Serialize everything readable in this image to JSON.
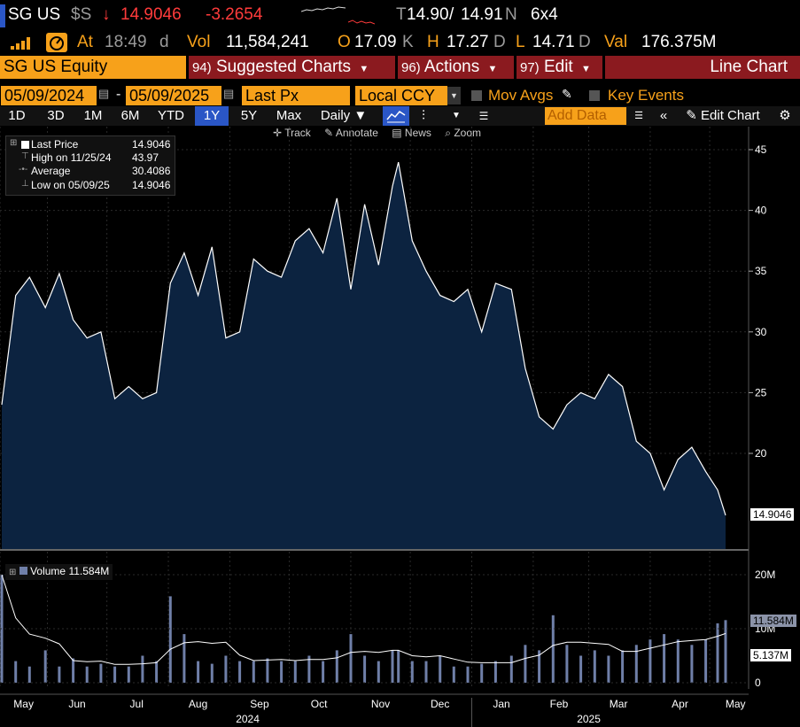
{
  "header": {
    "ticker": "SG US",
    "currency_flag": "$S",
    "arrow": "↓",
    "last_price": "14.9046",
    "change": "-3.2654",
    "quote_prefix": "T",
    "bid": "14.90",
    "sep": "/",
    "ask": "14.91",
    "quote_suffix": "N",
    "size": "6x4",
    "at_label": "At",
    "time": "18:49",
    "time_suffix": "d",
    "vol_label": "Vol",
    "volume": "11,584,241",
    "open_label": "O",
    "open": "17.09",
    "open_suffix": "K",
    "high_label": "H",
    "high": "17.27",
    "high_suffix": "D",
    "low_label": "L",
    "low": "14.71",
    "low_suffix": "D",
    "val_label": "Val",
    "value": "176.375M"
  },
  "menu": {
    "security": "SG US Equity",
    "suggested_num": "94)",
    "suggested": "Suggested Charts",
    "actions_num": "96)",
    "actions": "Actions",
    "edit_num": "97)",
    "edit": "Edit",
    "chart_type": "Line Chart"
  },
  "controls": {
    "start_date": "05/09/2024",
    "dash": "-",
    "end_date": "05/09/2025",
    "field": "Last Px",
    "currency": "Local CCY",
    "mov_avgs": "Mov Avgs",
    "key_events": "Key Events",
    "ranges": [
      "1D",
      "3D",
      "1M",
      "6M",
      "YTD",
      "1Y",
      "5Y",
      "Max"
    ],
    "active_range": "1Y",
    "frequency": "Daily ▼",
    "add_data": "Add Data",
    "edit_chart": "Edit Chart"
  },
  "tools": {
    "track": "Track",
    "annotate": "Annotate",
    "news": "News",
    "zoom": "Zoom"
  },
  "legend": {
    "last_price_label": "Last Price",
    "last_price_value": "14.9046",
    "high_label": "High on 11/25/24",
    "high_value": "43.97",
    "average_label": "Average",
    "average_value": "30.4086",
    "low_label": "Low on 05/09/25",
    "low_value": "14.9046",
    "volume_label": "Volume 11.584M"
  },
  "colors": {
    "accent_orange": "#f7a11a",
    "menu_red": "#8b1a1f",
    "price_down": "#ff3b3b",
    "area_fill": "#0c2340",
    "volume_bar": "#6f7fa8"
  },
  "chart_data": [
    {
      "type": "area",
      "x": [
        "2024-05-09",
        "2024-05-16",
        "2024-05-23",
        "2024-05-31",
        "2024-06-07",
        "2024-06-14",
        "2024-06-21",
        "2024-06-28",
        "2024-07-05",
        "2024-07-12",
        "2024-07-19",
        "2024-07-26",
        "2024-08-02",
        "2024-08-09",
        "2024-08-16",
        "2024-08-23",
        "2024-08-30",
        "2024-09-06",
        "2024-09-13",
        "2024-09-20",
        "2024-09-27",
        "2024-10-04",
        "2024-10-11",
        "2024-10-18",
        "2024-10-25",
        "2024-11-01",
        "2024-11-08",
        "2024-11-15",
        "2024-11-22",
        "2024-11-25",
        "2024-12-02",
        "2024-12-09",
        "2024-12-16",
        "2024-12-23",
        "2024-12-30",
        "2025-01-06",
        "2025-01-13",
        "2025-01-21",
        "2025-01-28",
        "2025-02-04",
        "2025-02-11",
        "2025-02-18",
        "2025-02-25",
        "2025-03-04",
        "2025-03-11",
        "2025-03-18",
        "2025-03-25",
        "2025-04-01",
        "2025-04-08",
        "2025-04-15",
        "2025-04-22",
        "2025-04-29",
        "2025-05-05",
        "2025-05-09"
      ],
      "y": [
        24.0,
        33.0,
        34.5,
        32.0,
        34.8,
        31.0,
        29.5,
        30.0,
        24.5,
        25.5,
        24.5,
        25.0,
        34.0,
        36.5,
        33.0,
        37.0,
        29.5,
        30.0,
        36.0,
        35.0,
        34.5,
        37.5,
        38.5,
        36.5,
        41.0,
        33.5,
        40.5,
        35.5,
        42.0,
        43.97,
        37.5,
        35.0,
        33.0,
        32.5,
        33.5,
        30.0,
        34.0,
        33.5,
        27.0,
        23.0,
        22.0,
        24.0,
        25.0,
        24.5,
        26.5,
        25.5,
        21.0,
        20.0,
        17.0,
        19.5,
        20.5,
        18.5,
        17.0,
        14.9046
      ],
      "ylim": [
        10,
        46
      ],
      "yticks": [
        20,
        25,
        30,
        35,
        40,
        45
      ],
      "price_tag": "14.9046"
    },
    {
      "type": "bar",
      "series": [
        {
          "name": "Volume 11.584M"
        }
      ],
      "values_m": [
        20.0,
        4.0,
        3.0,
        6.0,
        3.0,
        4.5,
        3.0,
        3.5,
        3.0,
        3.0,
        5.0,
        4.0,
        16.0,
        9.0,
        4.0,
        3.5,
        5.0,
        4.0,
        4.0,
        4.5,
        4.0,
        4.0,
        5.0,
        4.0,
        6.0,
        9.0,
        5.0,
        4.0,
        6.0,
        6.0,
        4.0,
        4.0,
        5.0,
        3.0,
        3.0,
        3.5,
        4.0,
        5.0,
        7.0,
        6.0,
        12.5,
        7.0,
        5.0,
        6.0,
        5.0,
        6.0,
        7.0,
        8.0,
        9.0,
        8.0,
        7.0,
        8.0,
        11.0,
        11.584
      ],
      "ylim": [
        0,
        23
      ],
      "yticks": [
        0,
        10,
        20
      ],
      "ytick_labels": [
        "0",
        "10M",
        "20M"
      ],
      "last_tag": "11.584M",
      "avg_tag": "5.137M"
    }
  ],
  "xaxis": {
    "months": [
      "May",
      "Jun",
      "Jul",
      "Aug",
      "Sep",
      "Oct",
      "Nov",
      "Dec",
      "Jan",
      "Feb",
      "Mar",
      "Apr",
      "May"
    ],
    "years": [
      "2024",
      "2025"
    ]
  }
}
